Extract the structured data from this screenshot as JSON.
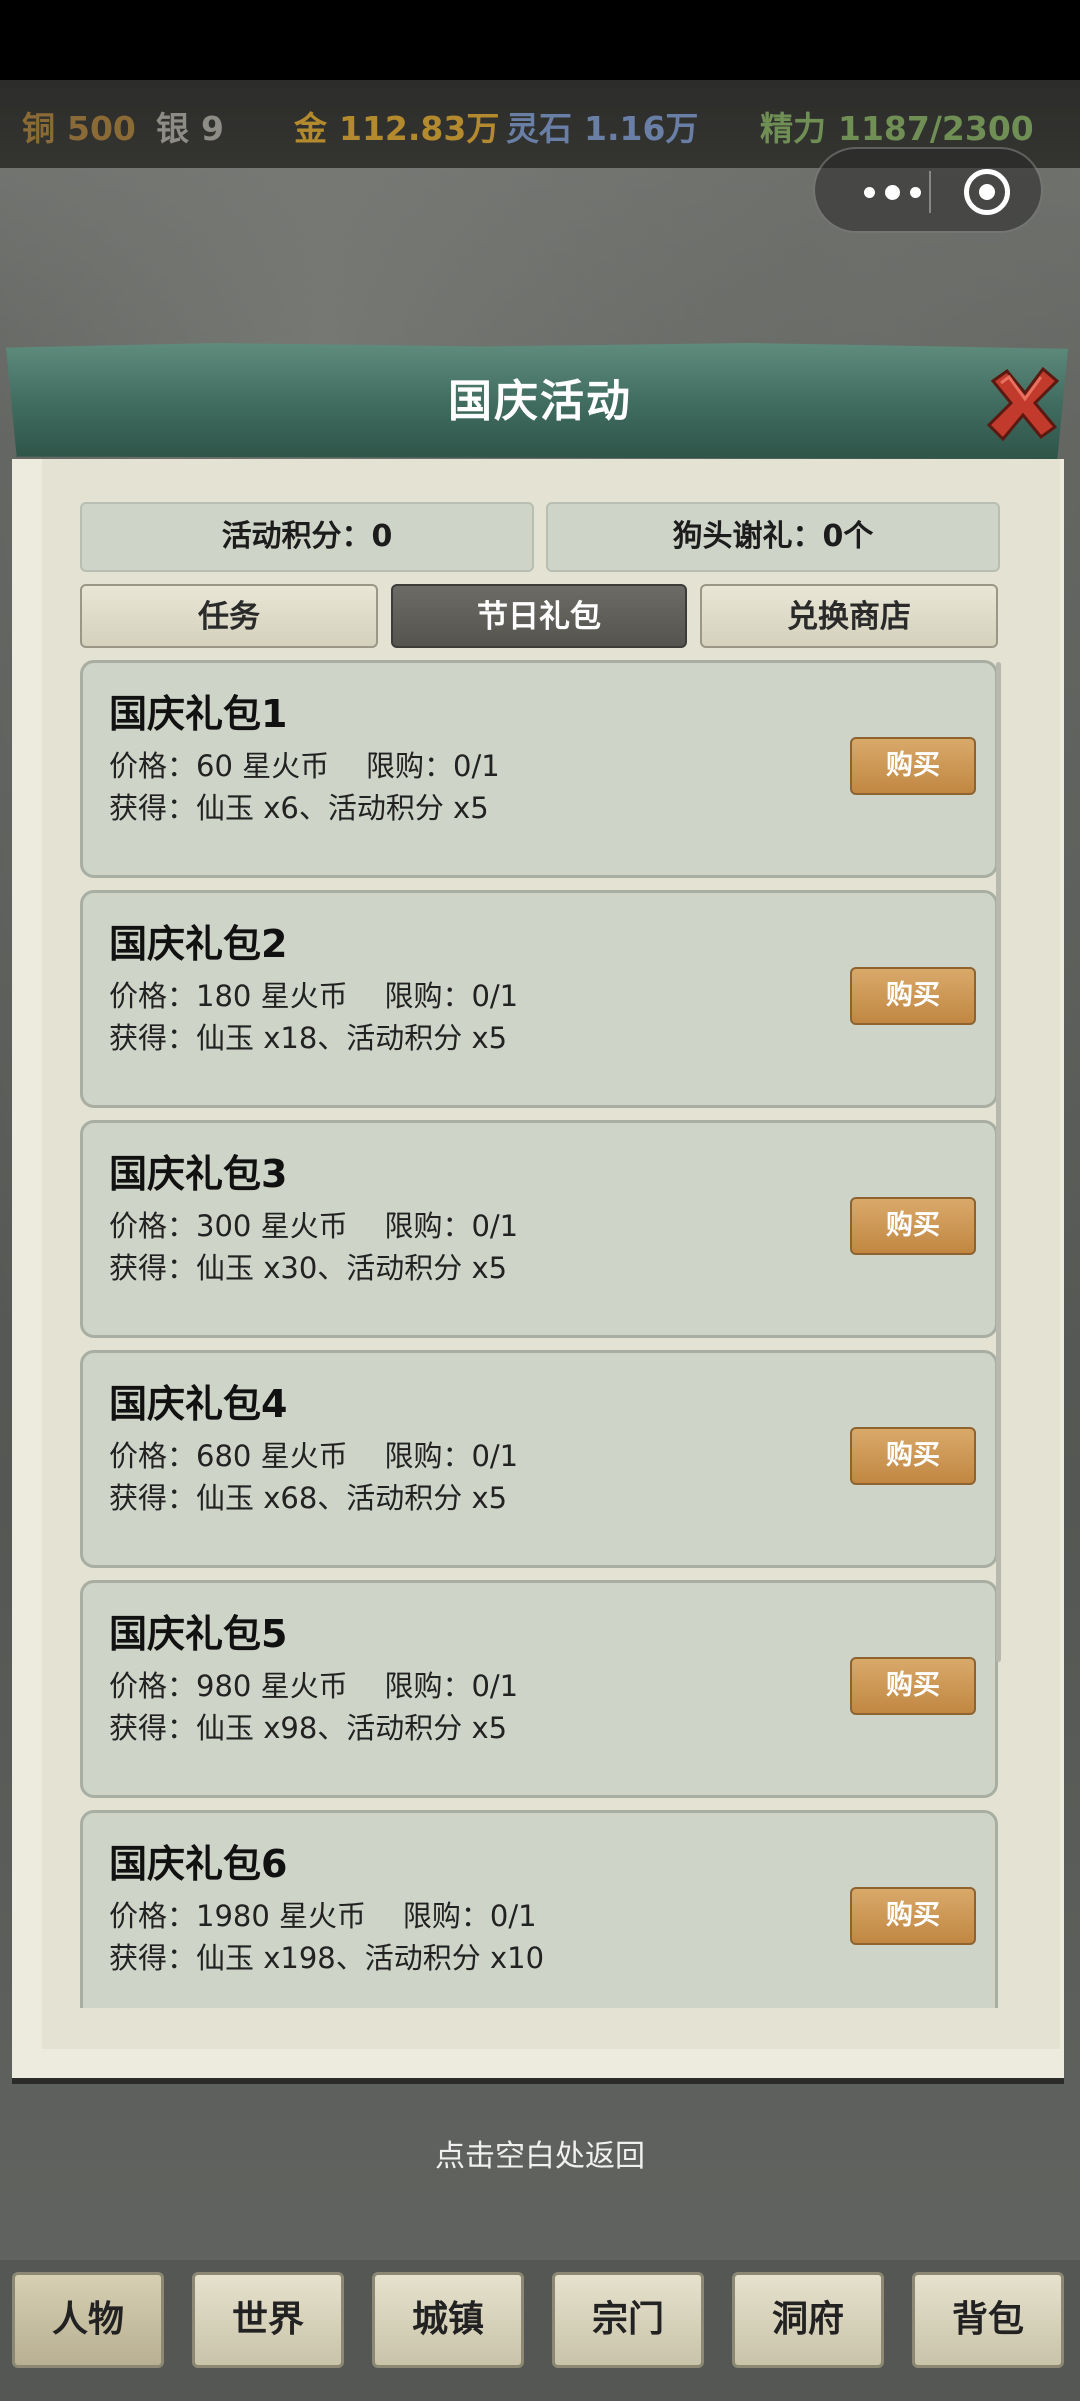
{
  "resources": [
    {
      "label": "铜",
      "value": "500",
      "color": "#a27a3a"
    },
    {
      "label": "银",
      "value": "9",
      "color": "#8d8c86"
    },
    {
      "label": "金",
      "value": "112.83万",
      "color": "#b48a2e"
    },
    {
      "label": "灵石",
      "value": "1.16万",
      "color": "#6a7fa6"
    },
    {
      "label": "精力",
      "value": "1187/2300",
      "color": "#6f8f55"
    }
  ],
  "modal": {
    "title": "国庆活动",
    "stats": {
      "points": "活动积分：0",
      "thanks": "狗头谢礼：0个"
    },
    "tabs": [
      "任务",
      "节日礼包",
      "兑换商店"
    ],
    "active_tab": "节日礼包",
    "packages": [
      {
        "name": "国庆礼包1",
        "price": "价格：60 星火币    限购：0/1",
        "reward": "获得：仙玉 x6、活动积分 x5",
        "button": "购买"
      },
      {
        "name": "国庆礼包2",
        "price": "价格：180 星火币    限购：0/1",
        "reward": "获得：仙玉 x18、活动积分 x5",
        "button": "购买"
      },
      {
        "name": "国庆礼包3",
        "price": "价格：300 星火币    限购：0/1",
        "reward": "获得：仙玉 x30、活动积分 x5",
        "button": "购买"
      },
      {
        "name": "国庆礼包4",
        "price": "价格：680 星火币    限购：0/1",
        "reward": "获得：仙玉 x68、活动积分 x5",
        "button": "购买"
      },
      {
        "name": "国庆礼包5",
        "price": "价格：980 星火币    限购：0/1",
        "reward": "获得：仙玉 x98、活动积分 x5",
        "button": "购买"
      },
      {
        "name": "国庆礼包6",
        "price": "价格：1980 星火币    限购：0/1",
        "reward": "获得：仙玉 x198、活动积分 x10",
        "button": "购买"
      }
    ],
    "hint": "点击空白处返回"
  },
  "nav": [
    "人物",
    "世界",
    "城镇",
    "宗门",
    "洞府",
    "背包"
  ],
  "nav_active": "人物"
}
